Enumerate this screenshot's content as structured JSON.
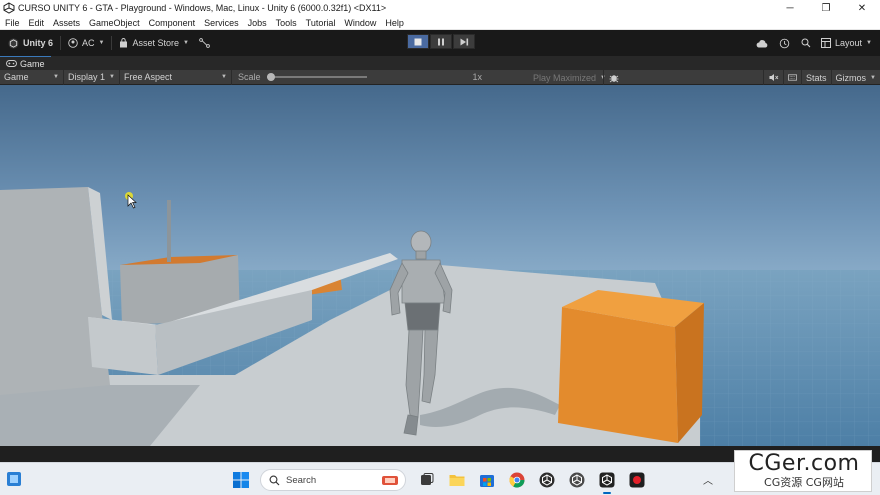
{
  "window": {
    "title": "CURSO UNITY 6 - GTA - Playground - Windows, Mac, Linux - Unity 6 (6000.0.32f1) <DX11>",
    "minimize": "─",
    "maximize": "❐",
    "close": "✕"
  },
  "menu": [
    "File",
    "Edit",
    "Assets",
    "GameObject",
    "Component",
    "Services",
    "Jobs",
    "Tools",
    "Tutorial",
    "Window",
    "Help"
  ],
  "toolbar": {
    "unity_label": "Unity 6",
    "account_label": "AC",
    "asset_store_label": "Asset Store",
    "layout_label": "Layout",
    "play_state": "playing",
    "accent": "#4a6aa0"
  },
  "tab": {
    "label": "Game"
  },
  "game_toolbar": {
    "mode": "Game",
    "display": "Display 1",
    "aspect": "Free Aspect",
    "scale_label": "Scale",
    "scale_value": "1x",
    "play_maximized": "Play Maximized",
    "stats": "Stats",
    "gizmos": "Gizmos"
  },
  "taskbar": {
    "search_placeholder": "Search",
    "apps": [
      "file-explorer-icon",
      "store-icon",
      "chrome-icon",
      "unity-hub-icon",
      "unity-icon",
      "unity-editor-icon",
      "record-icon"
    ]
  },
  "watermark": {
    "main": "CGer.com",
    "sub": "CG资源 CG网站"
  },
  "colors": {
    "sky_top": "#4a6f93",
    "sky_bottom": "#a9c9e0",
    "orange_box": "#e38b2d",
    "floor": "#c9cfd2"
  }
}
